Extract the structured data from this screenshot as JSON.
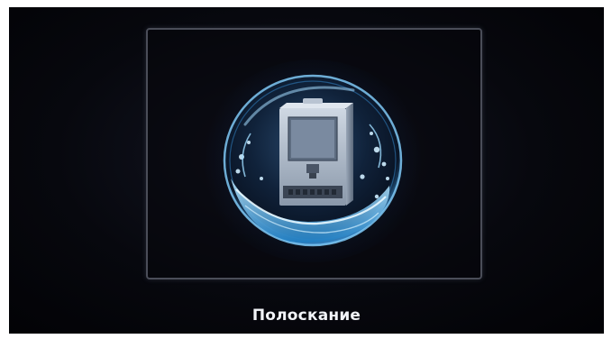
{
  "status": {
    "caption": "Полоскание"
  },
  "colors": {
    "background": "#05060b",
    "frame_border": "#4a4d58",
    "water_accent": "#4fb3f0",
    "caption_text": "#f2f4f8"
  },
  "icons": {
    "main": "coffee-machine-rinse-icon"
  }
}
